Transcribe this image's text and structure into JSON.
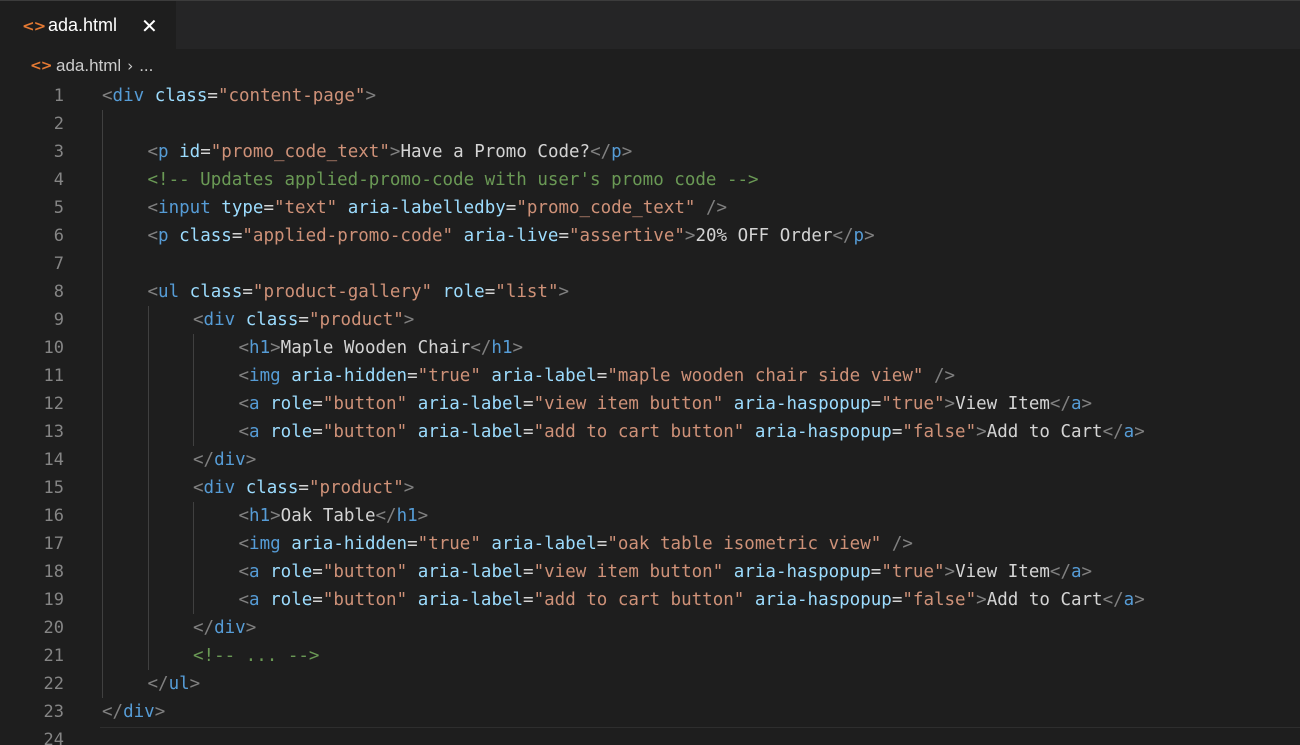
{
  "tab": {
    "icon": "html-file-icon",
    "label": "ada.html",
    "close": "✕"
  },
  "breadcrumb": {
    "icon": "html-file-icon",
    "file": "ada.html",
    "separator": "›",
    "more": "..."
  },
  "colors": {
    "tag": "#569cd6",
    "bracket": "#808080",
    "attribute": "#9cdcfe",
    "string": "#ce9178",
    "text": "#d4d4d4",
    "comment": "#6a9955",
    "line_number": "#858585",
    "icon_accent": "#e37933"
  },
  "lines": [
    {
      "n": "1",
      "indent": 0,
      "tokens": [
        [
          "b",
          "<"
        ],
        [
          "t",
          "div"
        ],
        [
          "x",
          " "
        ],
        [
          "a",
          "class"
        ],
        [
          "e",
          "="
        ],
        [
          "s",
          "\"content-page\""
        ],
        [
          "b",
          ">"
        ]
      ]
    },
    {
      "n": "2",
      "indent": 0,
      "tokens": []
    },
    {
      "n": "3",
      "indent": 1,
      "tokens": [
        [
          "b",
          "<"
        ],
        [
          "t",
          "p"
        ],
        [
          "x",
          " "
        ],
        [
          "a",
          "id"
        ],
        [
          "e",
          "="
        ],
        [
          "s",
          "\"promo_code_text\""
        ],
        [
          "b",
          ">"
        ],
        [
          "x",
          "Have a Promo Code?"
        ],
        [
          "b",
          "</"
        ],
        [
          "t",
          "p"
        ],
        [
          "b",
          ">"
        ]
      ]
    },
    {
      "n": "4",
      "indent": 1,
      "tokens": [
        [
          "c",
          "<!-- Updates applied-promo-code with user's promo code -->"
        ]
      ]
    },
    {
      "n": "5",
      "indent": 1,
      "tokens": [
        [
          "b",
          "<"
        ],
        [
          "t",
          "input"
        ],
        [
          "x",
          " "
        ],
        [
          "a",
          "type"
        ],
        [
          "e",
          "="
        ],
        [
          "s",
          "\"text\""
        ],
        [
          "x",
          " "
        ],
        [
          "a",
          "aria-labelledby"
        ],
        [
          "e",
          "="
        ],
        [
          "s",
          "\"promo_code_text\""
        ],
        [
          "x",
          " "
        ],
        [
          "b",
          "/>"
        ]
      ]
    },
    {
      "n": "6",
      "indent": 1,
      "tokens": [
        [
          "b",
          "<"
        ],
        [
          "t",
          "p"
        ],
        [
          "x",
          " "
        ],
        [
          "a",
          "class"
        ],
        [
          "e",
          "="
        ],
        [
          "s",
          "\"applied-promo-code\""
        ],
        [
          "x",
          " "
        ],
        [
          "a",
          "aria-live"
        ],
        [
          "e",
          "="
        ],
        [
          "s",
          "\"assertive\""
        ],
        [
          "b",
          ">"
        ],
        [
          "x",
          "20% OFF Order"
        ],
        [
          "b",
          "</"
        ],
        [
          "t",
          "p"
        ],
        [
          "b",
          ">"
        ]
      ]
    },
    {
      "n": "7",
      "indent": 0,
      "tokens": []
    },
    {
      "n": "8",
      "indent": 1,
      "tokens": [
        [
          "b",
          "<"
        ],
        [
          "t",
          "ul"
        ],
        [
          "x",
          " "
        ],
        [
          "a",
          "class"
        ],
        [
          "e",
          "="
        ],
        [
          "s",
          "\"product-gallery\""
        ],
        [
          "x",
          " "
        ],
        [
          "a",
          "role"
        ],
        [
          "e",
          "="
        ],
        [
          "s",
          "\"list\""
        ],
        [
          "b",
          ">"
        ]
      ]
    },
    {
      "n": "9",
      "indent": 2,
      "tokens": [
        [
          "b",
          "<"
        ],
        [
          "t",
          "div"
        ],
        [
          "x",
          " "
        ],
        [
          "a",
          "class"
        ],
        [
          "e",
          "="
        ],
        [
          "s",
          "\"product\""
        ],
        [
          "b",
          ">"
        ]
      ]
    },
    {
      "n": "10",
      "indent": 3,
      "tokens": [
        [
          "b",
          "<"
        ],
        [
          "t",
          "h1"
        ],
        [
          "b",
          ">"
        ],
        [
          "x",
          "Maple Wooden Chair"
        ],
        [
          "b",
          "</"
        ],
        [
          "t",
          "h1"
        ],
        [
          "b",
          ">"
        ]
      ]
    },
    {
      "n": "11",
      "indent": 3,
      "tokens": [
        [
          "b",
          "<"
        ],
        [
          "t",
          "img"
        ],
        [
          "x",
          " "
        ],
        [
          "a",
          "aria-hidden"
        ],
        [
          "e",
          "="
        ],
        [
          "s",
          "\"true\""
        ],
        [
          "x",
          " "
        ],
        [
          "a",
          "aria-label"
        ],
        [
          "e",
          "="
        ],
        [
          "s",
          "\"maple wooden chair side view\""
        ],
        [
          "x",
          " "
        ],
        [
          "b",
          "/>"
        ]
      ]
    },
    {
      "n": "12",
      "indent": 3,
      "tokens": [
        [
          "b",
          "<"
        ],
        [
          "t",
          "a"
        ],
        [
          "x",
          " "
        ],
        [
          "a",
          "role"
        ],
        [
          "e",
          "="
        ],
        [
          "s",
          "\"button\""
        ],
        [
          "x",
          " "
        ],
        [
          "a",
          "aria-label"
        ],
        [
          "e",
          "="
        ],
        [
          "s",
          "\"view item button\""
        ],
        [
          "x",
          " "
        ],
        [
          "a",
          "aria-haspopup"
        ],
        [
          "e",
          "="
        ],
        [
          "s",
          "\"true\""
        ],
        [
          "b",
          ">"
        ],
        [
          "x",
          "View Item"
        ],
        [
          "b",
          "</"
        ],
        [
          "t",
          "a"
        ],
        [
          "b",
          ">"
        ]
      ]
    },
    {
      "n": "13",
      "indent": 3,
      "tokens": [
        [
          "b",
          "<"
        ],
        [
          "t",
          "a"
        ],
        [
          "x",
          " "
        ],
        [
          "a",
          "role"
        ],
        [
          "e",
          "="
        ],
        [
          "s",
          "\"button\""
        ],
        [
          "x",
          " "
        ],
        [
          "a",
          "aria-label"
        ],
        [
          "e",
          "="
        ],
        [
          "s",
          "\"add to cart button\""
        ],
        [
          "x",
          " "
        ],
        [
          "a",
          "aria-haspopup"
        ],
        [
          "e",
          "="
        ],
        [
          "s",
          "\"false\""
        ],
        [
          "b",
          ">"
        ],
        [
          "x",
          "Add to Cart"
        ],
        [
          "b",
          "</"
        ],
        [
          "t",
          "a"
        ],
        [
          "b",
          ">"
        ]
      ]
    },
    {
      "n": "14",
      "indent": 2,
      "tokens": [
        [
          "b",
          "</"
        ],
        [
          "t",
          "div"
        ],
        [
          "b",
          ">"
        ]
      ]
    },
    {
      "n": "15",
      "indent": 2,
      "tokens": [
        [
          "b",
          "<"
        ],
        [
          "t",
          "div"
        ],
        [
          "x",
          " "
        ],
        [
          "a",
          "class"
        ],
        [
          "e",
          "="
        ],
        [
          "s",
          "\"product\""
        ],
        [
          "b",
          ">"
        ]
      ]
    },
    {
      "n": "16",
      "indent": 3,
      "tokens": [
        [
          "b",
          "<"
        ],
        [
          "t",
          "h1"
        ],
        [
          "b",
          ">"
        ],
        [
          "x",
          "Oak Table"
        ],
        [
          "b",
          "</"
        ],
        [
          "t",
          "h1"
        ],
        [
          "b",
          ">"
        ]
      ]
    },
    {
      "n": "17",
      "indent": 3,
      "tokens": [
        [
          "b",
          "<"
        ],
        [
          "t",
          "img"
        ],
        [
          "x",
          " "
        ],
        [
          "a",
          "aria-hidden"
        ],
        [
          "e",
          "="
        ],
        [
          "s",
          "\"true\""
        ],
        [
          "x",
          " "
        ],
        [
          "a",
          "aria-label"
        ],
        [
          "e",
          "="
        ],
        [
          "s",
          "\"oak table isometric view\""
        ],
        [
          "x",
          " "
        ],
        [
          "b",
          "/>"
        ]
      ]
    },
    {
      "n": "18",
      "indent": 3,
      "tokens": [
        [
          "b",
          "<"
        ],
        [
          "t",
          "a"
        ],
        [
          "x",
          " "
        ],
        [
          "a",
          "role"
        ],
        [
          "e",
          "="
        ],
        [
          "s",
          "\"button\""
        ],
        [
          "x",
          " "
        ],
        [
          "a",
          "aria-label"
        ],
        [
          "e",
          "="
        ],
        [
          "s",
          "\"view item button\""
        ],
        [
          "x",
          " "
        ],
        [
          "a",
          "aria-haspopup"
        ],
        [
          "e",
          "="
        ],
        [
          "s",
          "\"true\""
        ],
        [
          "b",
          ">"
        ],
        [
          "x",
          "View Item"
        ],
        [
          "b",
          "</"
        ],
        [
          "t",
          "a"
        ],
        [
          "b",
          ">"
        ]
      ]
    },
    {
      "n": "19",
      "indent": 3,
      "tokens": [
        [
          "b",
          "<"
        ],
        [
          "t",
          "a"
        ],
        [
          "x",
          " "
        ],
        [
          "a",
          "role"
        ],
        [
          "e",
          "="
        ],
        [
          "s",
          "\"button\""
        ],
        [
          "x",
          " "
        ],
        [
          "a",
          "aria-label"
        ],
        [
          "e",
          "="
        ],
        [
          "s",
          "\"add to cart button\""
        ],
        [
          "x",
          " "
        ],
        [
          "a",
          "aria-haspopup"
        ],
        [
          "e",
          "="
        ],
        [
          "s",
          "\"false\""
        ],
        [
          "b",
          ">"
        ],
        [
          "x",
          "Add to Cart"
        ],
        [
          "b",
          "</"
        ],
        [
          "t",
          "a"
        ],
        [
          "b",
          ">"
        ]
      ]
    },
    {
      "n": "20",
      "indent": 2,
      "tokens": [
        [
          "b",
          "</"
        ],
        [
          "t",
          "div"
        ],
        [
          "b",
          ">"
        ]
      ]
    },
    {
      "n": "21",
      "indent": 2,
      "tokens": [
        [
          "c",
          "<!-- ... -->"
        ]
      ]
    },
    {
      "n": "22",
      "indent": 1,
      "tokens": [
        [
          "b",
          "</"
        ],
        [
          "t",
          "ul"
        ],
        [
          "b",
          ">"
        ]
      ]
    },
    {
      "n": "23",
      "indent": 0,
      "tokens": [
        [
          "b",
          "</"
        ],
        [
          "t",
          "div"
        ],
        [
          "b",
          ">"
        ]
      ]
    },
    {
      "n": "24",
      "indent": 0,
      "tokens": []
    }
  ]
}
